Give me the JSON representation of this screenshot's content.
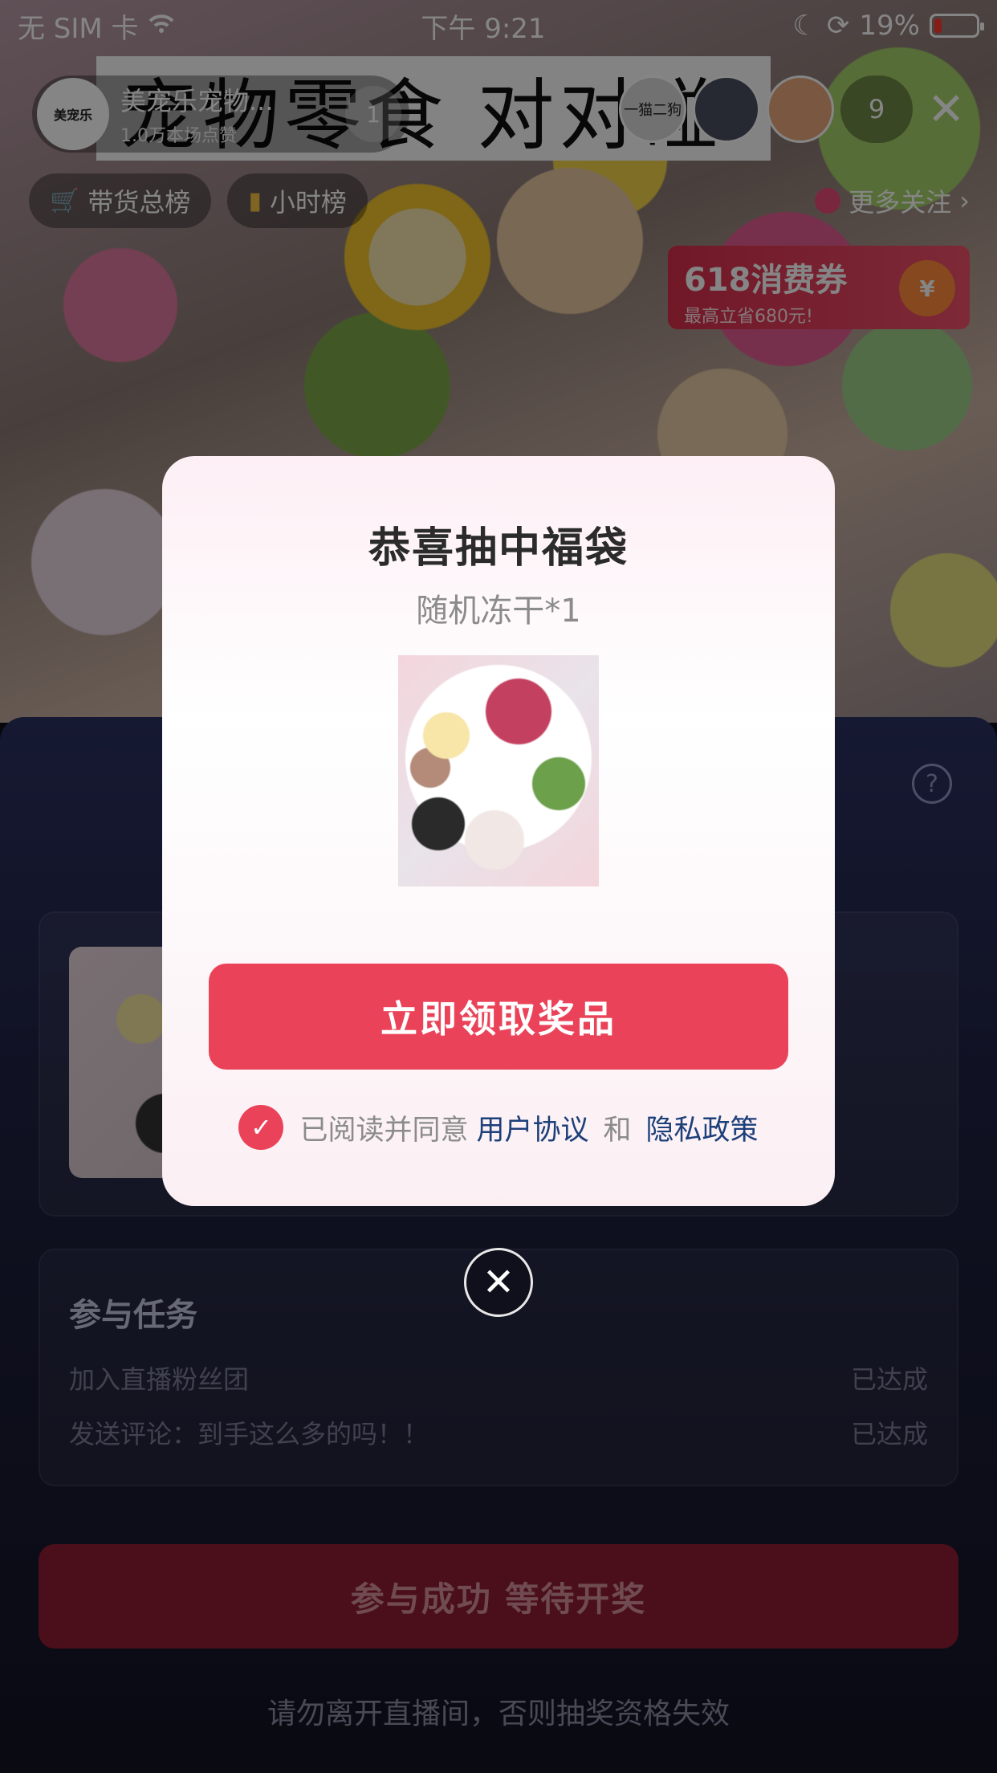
{
  "status_bar": {
    "carrier": "无 SIM 卡",
    "time": "下午 9:21",
    "battery_pct": "19%",
    "battery_level": 0.19,
    "battery_color": "#ff3b30"
  },
  "stream": {
    "title": "宠物零食 对对碰",
    "host_name": "美宠乐宠物...",
    "host_logo": "美宠乐",
    "host_likes": "1.0万本场点赞",
    "follow_count": "1",
    "viewer1_label": "一猫二狗",
    "viewer_count": "9",
    "close_icon": "close-icon",
    "rank_labels": [
      "带货总榜",
      "小时榜"
    ],
    "follow_more": "更多关注",
    "coupon_title": "618消费券",
    "coupon_sub": "最高立省680元!",
    "coupon_icon_text": "¥"
  },
  "panel": {
    "task_title": "参与任务",
    "tasks": [
      {
        "name": "加入直播粉丝团",
        "status": "已达成"
      },
      {
        "name": "发送评论：到手这么多的吗！！",
        "status": "已达成"
      }
    ],
    "join_button": "参与成功 等待开奖",
    "warning": "请勿离开直播间，否则抽奖资格失效",
    "help_icon": "?"
  },
  "modal": {
    "title": "恭喜抽中福袋",
    "prize": "随机冻干*1",
    "claim_button": "立即领取奖品",
    "agree_prefix": "已阅读并同意",
    "user_agreement": "用户协议",
    "and": "和",
    "privacy_policy": "隐私政策",
    "accent_color": "#ea4359",
    "close_glyph": "✕"
  }
}
